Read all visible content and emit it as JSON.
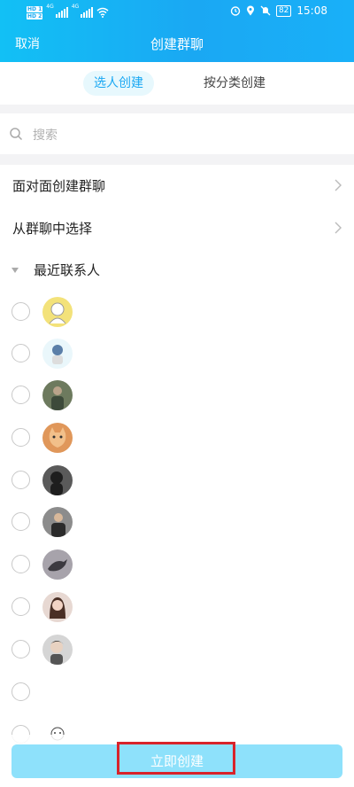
{
  "status_bar": {
    "tags": [
      "HD 1",
      "HD 2"
    ],
    "network_1": "4G",
    "network_2": "4G",
    "battery": "82",
    "time": "15:08",
    "icons": [
      "alarm-icon",
      "location-icon",
      "mute-icon"
    ]
  },
  "nav": {
    "cancel_label": "取消",
    "title": "创建群聊"
  },
  "tabs": [
    {
      "label": "选人创建",
      "active": true
    },
    {
      "label": "按分类创建",
      "active": false
    }
  ],
  "search": {
    "placeholder": "搜索"
  },
  "menu": [
    {
      "label": "面对面创建群聊"
    },
    {
      "label": "从群聊中选择"
    }
  ],
  "recent_section": {
    "label": "最近联系人"
  },
  "contacts": [
    {
      "name": "",
      "avatar": "illustration-avatar"
    },
    {
      "name": "",
      "avatar": "cartoon-avatar"
    },
    {
      "name": "",
      "avatar": "photo-avatar"
    },
    {
      "name": "",
      "avatar": "cat-avatar"
    },
    {
      "name": "",
      "avatar": "dark-avatar"
    },
    {
      "name": "",
      "avatar": "person-avatar"
    },
    {
      "name": "",
      "avatar": "bird-avatar"
    },
    {
      "name": "",
      "avatar": "girl-avatar"
    },
    {
      "name": "",
      "avatar": "man-avatar"
    },
    {
      "name": "",
      "avatar": "blank-avatar"
    },
    {
      "name": "",
      "avatar": "sketch-avatar"
    }
  ],
  "footer": {
    "create_label": "立即创建"
  },
  "colors": {
    "header": "#1aa8f3",
    "accent": "#1aa8f3",
    "button": "#8ee1fb",
    "highlight": "#d8232a"
  }
}
